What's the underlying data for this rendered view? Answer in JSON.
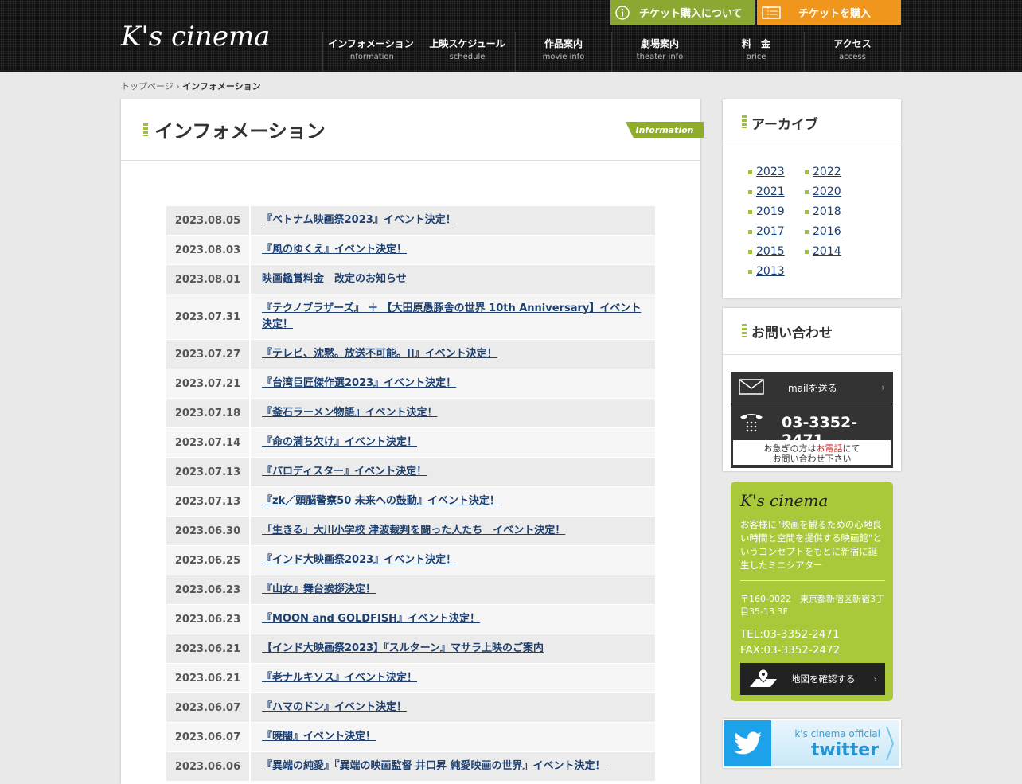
{
  "header": {
    "logo": "K's cinema",
    "top_buttons": {
      "ticket_info": "チケット購入について",
      "buy_ticket": "チケットを購入"
    },
    "nav": [
      {
        "jp": "インフォメーション",
        "en": "information"
      },
      {
        "jp": "上映スケジュール",
        "en": "schedule"
      },
      {
        "jp": "作品案内",
        "en": "movie info"
      },
      {
        "jp": "劇場案内",
        "en": "theater info"
      },
      {
        "jp": "料　金",
        "en": "price"
      },
      {
        "jp": "アクセス",
        "en": "access"
      }
    ]
  },
  "breadcrumb": {
    "home": "トップページ",
    "separator": "›",
    "current": "インフォメーション"
  },
  "main": {
    "title": "インフォメーション",
    "tag": "Information",
    "news": [
      {
        "date": "2023.08.05",
        "title": "『ベトナム映画祭2023』イベント決定！"
      },
      {
        "date": "2023.08.03",
        "title": "『風のゆくえ』イベント決定！"
      },
      {
        "date": "2023.08.01",
        "title": "映画鑑賞料金　改定のお知らせ"
      },
      {
        "date": "2023.07.31",
        "title": "『テクノブラザーズ』 ＋ 【大田原愚豚舎の世界 10th Anniversary】イベント決定！"
      },
      {
        "date": "2023.07.27",
        "title": "『テレビ、沈黙。放送不可能。II』イベント決定！"
      },
      {
        "date": "2023.07.21",
        "title": "『台湾巨匠傑作選2023』イベント決定！"
      },
      {
        "date": "2023.07.18",
        "title": "『釜石ラーメン物語』イベント決定！"
      },
      {
        "date": "2023.07.14",
        "title": "『命の満ち欠け』イベント決定！"
      },
      {
        "date": "2023.07.13",
        "title": "『パロディスター』イベント決定！"
      },
      {
        "date": "2023.07.13",
        "title": "『zk／頭脳警察50 未来への鼓動』イベント決定！"
      },
      {
        "date": "2023.06.30",
        "title": "「生きる」大川小学校 津波裁判を闘った人たち　イベント決定！"
      },
      {
        "date": "2023.06.25",
        "title": "『インド大映画祭2023』イベント決定！"
      },
      {
        "date": "2023.06.23",
        "title": "『山女』舞台挨拶決定！"
      },
      {
        "date": "2023.06.23",
        "title": "『MOON and GOLDFISH』イベント決定！"
      },
      {
        "date": "2023.06.21",
        "title": "【インド大映画祭2023】『スルターン』マサラ上映のご案内"
      },
      {
        "date": "2023.06.21",
        "title": "『老ナルキソス』イベント決定！"
      },
      {
        "date": "2023.06.07",
        "title": "『ハマのドン』イベント決定！"
      },
      {
        "date": "2023.06.07",
        "title": "『暁闇』イベント決定！"
      },
      {
        "date": "2023.06.06",
        "title": "『異端の純愛』『異端の映画監督 井口昇 純愛映画の世界』イベント決定！"
      }
    ]
  },
  "archive": {
    "title": "アーカイブ",
    "years": [
      "2023",
      "2022",
      "2021",
      "2020",
      "2019",
      "2018",
      "2017",
      "2016",
      "2015",
      "2014",
      "2013"
    ]
  },
  "contact": {
    "title": "お問い合わせ",
    "mail_label": "mailを送る",
    "tel": "03-3352-2471",
    "note_pre": "お急ぎの方は",
    "note_red": "お電話",
    "note_post": "にて",
    "note_line2": "お問い合わせ下さい"
  },
  "about": {
    "logo": "K's cinema",
    "description": "お客様に\"映画を観るための心地良い時間と空間を提供する映画館\"というコンセプトをもとに新宿に誕生したミニシアター",
    "address": "〒160-0022　東京都新宿区新宿3丁目35-13 3F",
    "tel": "TEL:03-3352-2471",
    "fax": "FAX:03-3352-2472",
    "map_button": "地図を確認する"
  },
  "twitter": {
    "small": "k's cinema official",
    "big": "twitter"
  },
  "colors": {
    "accent_green": "#a9c93b",
    "orange": "#f1961c",
    "link": "#1c3f6f",
    "twitter_blue": "#1da1e8"
  }
}
